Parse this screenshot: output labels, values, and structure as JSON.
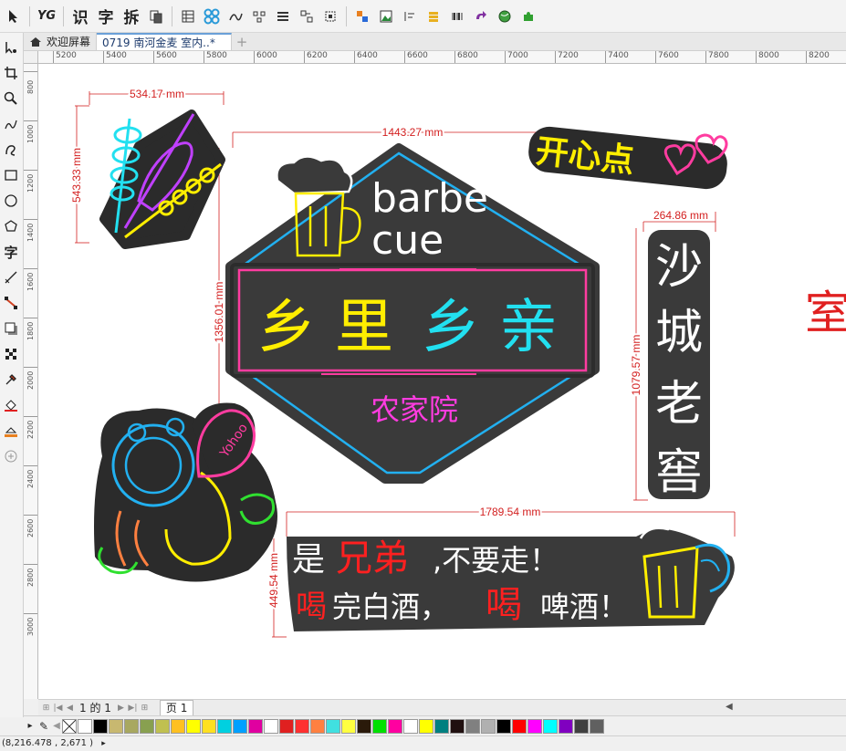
{
  "toolbar": {
    "items": [
      {
        "name": "yg-plugin-button",
        "label": "YG"
      },
      {
        "name": "recognize-text-button",
        "label": "识"
      },
      {
        "name": "char-button",
        "label": "字"
      },
      {
        "name": "split-button",
        "label": "拆"
      }
    ]
  },
  "tabs": {
    "welcome": "欢迎屏幕",
    "document": "0719 南河金麦 室内..*",
    "add": "+"
  },
  "ruler": {
    "h_ticks": [
      "5200",
      "5400",
      "5600",
      "5800",
      "6000",
      "6200",
      "6400",
      "6600",
      "6800",
      "7000",
      "7200",
      "7400",
      "7600",
      "7800",
      "8000",
      "8200"
    ],
    "v_ticks": [
      "800",
      "1000",
      "1200",
      "1400",
      "1600",
      "1800",
      "2000",
      "2200",
      "2400",
      "2600",
      "2800",
      "3000"
    ]
  },
  "dimensions": {
    "skewer_width": "534.17 mm",
    "skewer_height": "543.33 mm",
    "main_width": "1443.27 mm",
    "main_height": "1356.01 mm",
    "sign_width": "264.86 mm",
    "sign_height": "1079.57 mm",
    "banner_width": "1789.54 mm",
    "banner_height": "449.54 mm"
  },
  "artwork": {
    "happy": "开心点",
    "barbe": "barbe",
    "cue": "cue",
    "title_chars": [
      "乡",
      "里",
      "乡",
      "亲"
    ],
    "subtitle": "农家院",
    "vertical_chars": [
      "沙",
      "城",
      "老",
      "窖"
    ],
    "bubble": "Yohoo",
    "banner_line1_a": "是",
    "banner_line1_b": "兄弟",
    "banner_line1_c": ",不要走！",
    "banner_line2_a": "喝",
    "banner_line2_b": "完白酒，",
    "banner_line2_c": "喝",
    "banner_line2_d": "啤酒！",
    "edge_char": "室"
  },
  "pagenav": {
    "page_info": "1 的 1",
    "page_tab": "页 1"
  },
  "palette": [
    "#ffffff",
    "#000000",
    "#c8b870",
    "#a8a860",
    "#88a050",
    "#c0c050",
    "#ffc020",
    "#ffff00",
    "#ffe020",
    "#00d0e0",
    "#00a0ff",
    "#e000a0",
    "#ffffff",
    "#e02020",
    "#ff3030",
    "#ff8040",
    "#40e0e0",
    "#ffff40",
    "#2a1a0a",
    "#00e000",
    "#ff00a0",
    "#ffffff",
    "#ffff00",
    "#008080",
    "#201010",
    "#808080",
    "#b0b0b0",
    "#000000",
    "#ff0000",
    "#ff00ff",
    "#00ffff",
    "#8000c0",
    "#404040",
    "#606060"
  ],
  "status": {
    "coords": "(8,216.478 , 2,671 )"
  },
  "colors": {
    "neon_yellow": "#ffee00",
    "neon_cyan": "#22e0f0",
    "neon_pink": "#ff3ca0",
    "neon_purple": "#c040ff",
    "neon_red": "#ff2020",
    "dark_plate": "#3a3a3a",
    "dim_red": "#d32020"
  }
}
